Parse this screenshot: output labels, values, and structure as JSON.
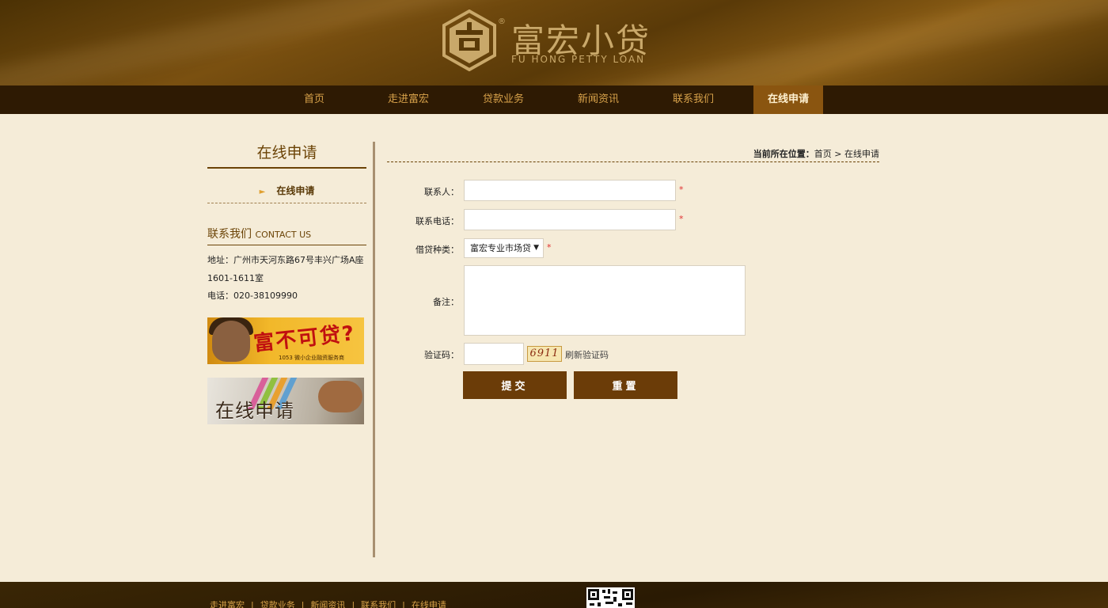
{
  "brand": {
    "name_cn": "富宏小贷",
    "name_en": "FU HONG PETTY LOAN",
    "registered": "®",
    "logo_icon": "fuhong-emblem-icon",
    "colors": {
      "gold": "#c9a86a",
      "nav_bg": "#2e1a03",
      "nav_active": "#8a5510",
      "brown": "#6b3c08"
    }
  },
  "nav": {
    "items": [
      "首页",
      "走进富宏",
      "贷款业务",
      "新闻资讯",
      "联系我们",
      "在线申请"
    ],
    "active": "在线申请"
  },
  "sidebar": {
    "title": "在线申请",
    "items": [
      "在线申请"
    ],
    "contact_title": "联系我们",
    "contact_title_en": "CONTACT US",
    "address_line1": "地址：广州市天河东路67号丰兴广场A座",
    "address_line2": "1601-1611室",
    "phone": "电话：020-38109990",
    "banner1_text": "富不可贷?",
    "banner1_small": "1053 微小企业融资服务商",
    "banner2_text": "在线申请"
  },
  "breadcrumb": {
    "label": "当前所在位置：",
    "home": "首页",
    "sep": " > ",
    "current": "在线申请"
  },
  "form": {
    "contact_label": "联系人：",
    "contact_value": "",
    "phone_label": "联系电话：",
    "phone_value": "",
    "loan_type_label": "借贷种类：",
    "loan_type_selected": "富宏专业市场贷",
    "notes_label": "备注：",
    "notes_value": "",
    "captcha_label": "验证码：",
    "captcha_value": "",
    "captcha_image_text": "6911",
    "refresh_label": "刷新验证码",
    "required_mark": "*",
    "submit_label": "提交",
    "reset_label": "重置"
  },
  "footer": {
    "links": [
      "走进富宏",
      "贷款业务",
      "新闻资讯",
      "联系我们",
      "在线申请"
    ],
    "separator": "|"
  }
}
